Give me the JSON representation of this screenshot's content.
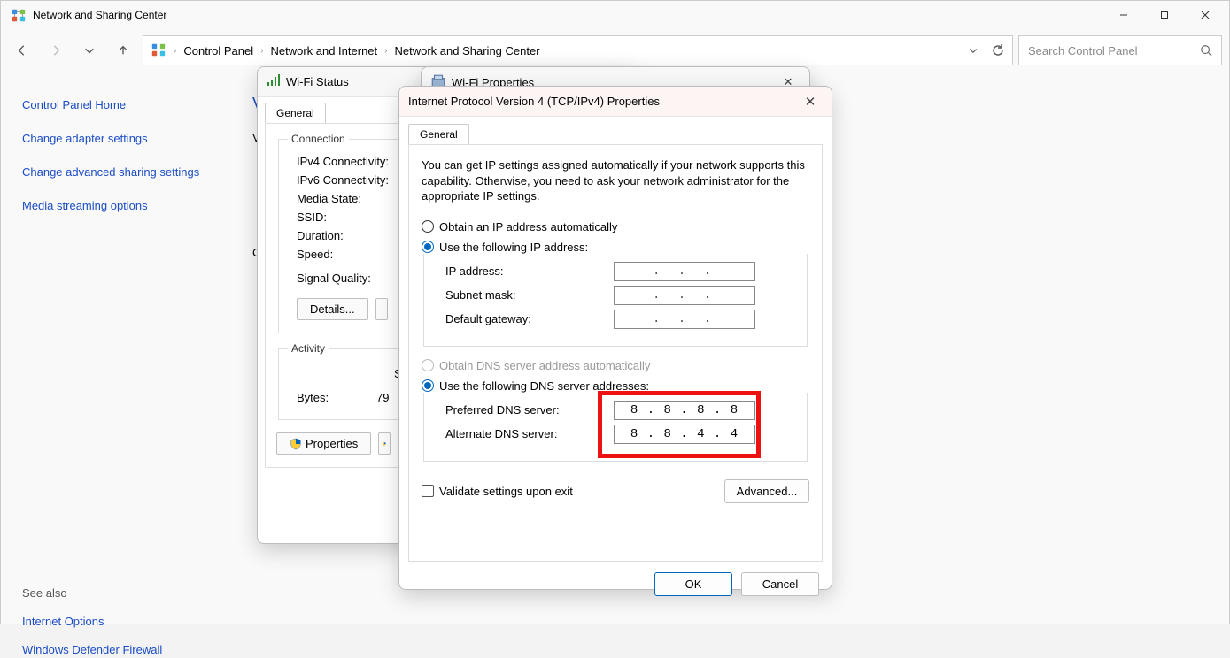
{
  "window": {
    "title": "Network and Sharing Center",
    "breadcrumbs": [
      "Control Panel",
      "Network and Internet",
      "Network and Sharing Center"
    ],
    "search_placeholder": "Search Control Panel"
  },
  "sidebar": {
    "home": "Control Panel Home",
    "links": [
      "Change adapter settings",
      "Change advanced sharing settings",
      "Media streaming options"
    ],
    "seealso_label": "See also",
    "seealso": [
      "Internet Options",
      "Windows Defender Firewall"
    ]
  },
  "main_stub": {
    "v1": "V",
    "v2": "V",
    "c": "C"
  },
  "wifi_status": {
    "title": "Wi-Fi Status",
    "tab": "General",
    "group_conn": "Connection",
    "group_act": "Activity",
    "rows": {
      "ipv4": "IPv4 Connectivity:",
      "ipv6": "IPv6 Connectivity:",
      "media": "Media State:",
      "ssid": "SSID:",
      "duration": "Duration:",
      "speed": "Speed:",
      "sigq": "Signal Quality:",
      "bytes": "Bytes:",
      "bytes_val_prefix": "79",
      "sent_marker": "S"
    },
    "buttons": {
      "details": "Details...",
      "properties": "Properties"
    }
  },
  "wifi_props": {
    "title": "Wi-Fi Properties"
  },
  "tcp": {
    "title": "Internet Protocol Version 4 (TCP/IPv4) Properties",
    "tab": "General",
    "description": "You can get IP settings assigned automatically if your network supports this capability. Otherwise, you need to ask your network administrator for the appropriate IP settings.",
    "ip_section": {
      "auto": "Obtain an IP address automatically",
      "manual": "Use the following IP address:",
      "ip_label": "IP address:",
      "mask_label": "Subnet mask:",
      "gw_label": "Default gateway:",
      "blank_ip": ".   .   ."
    },
    "dns_section": {
      "auto": "Obtain DNS server address automatically",
      "manual": "Use the following DNS server addresses:",
      "pref_label": "Preferred DNS server:",
      "alt_label": "Alternate DNS server:",
      "pref_val": "8 . 8 . 8 . 8",
      "alt_val": "8 . 8 . 4 . 4"
    },
    "validate": "Validate settings upon exit",
    "advanced": "Advanced...",
    "ok": "OK",
    "cancel": "Cancel"
  }
}
